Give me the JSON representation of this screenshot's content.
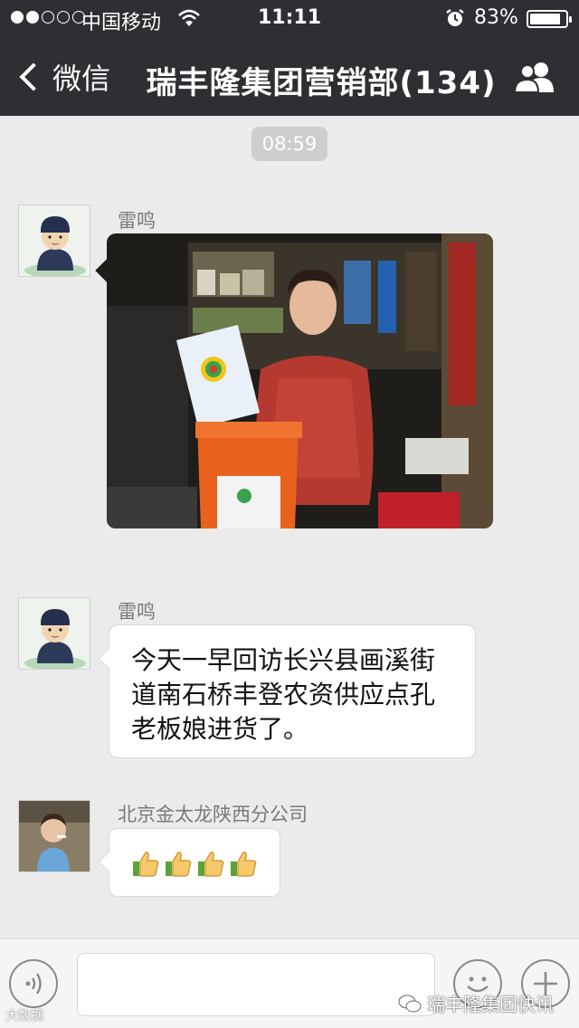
{
  "status_bar": {
    "carrier": "中国移动",
    "time": "11:11",
    "battery_percent": "83%",
    "battery_level": 0.83
  },
  "nav": {
    "back_label": "微信",
    "title": "瑞丰隆集团营销部(134)"
  },
  "chat": {
    "timestamp": "08:59",
    "messages": [
      {
        "sender": "雷鸣",
        "type": "image"
      },
      {
        "sender": "雷鸣",
        "type": "text",
        "text": "今天一早回访长兴县画溪街道南石桥丰登农资供应点孔老板娘进货了。"
      },
      {
        "sender": "北京金太龙陕西分公司",
        "type": "emoji",
        "emoji": [
          "👍",
          "👍",
          "👍",
          "👍"
        ]
      }
    ]
  },
  "watermark": {
    "right": "瑞丰隆集团快讯",
    "left": "大数据"
  },
  "colors": {
    "nav_bg": "#2e2f33",
    "chat_bg": "#ebebeb",
    "bubble": "#ffffff",
    "bucket_orange": "#e8621e"
  }
}
